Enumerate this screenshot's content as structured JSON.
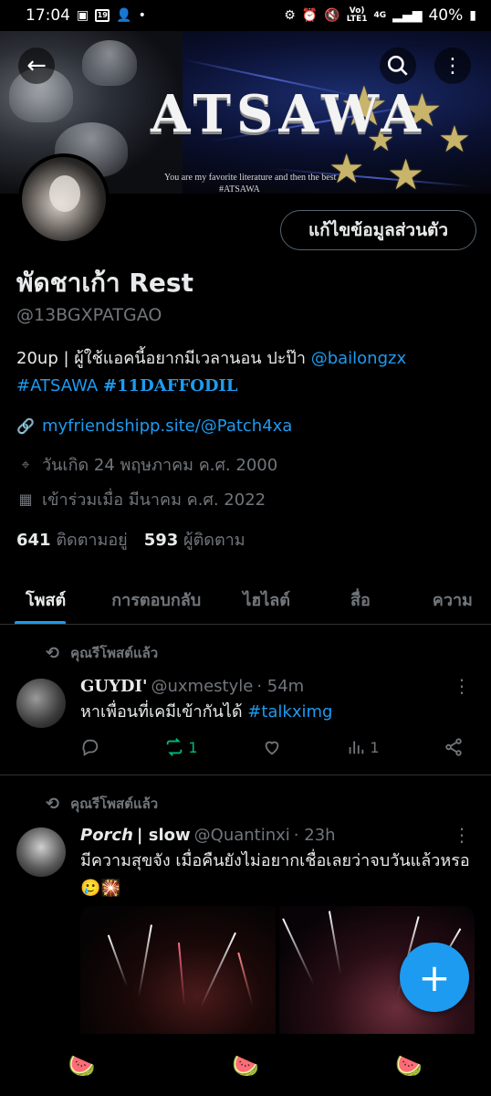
{
  "status_bar": {
    "time": "17:04",
    "notif_badge": "19",
    "net_top": "Vo)",
    "net_bottom": "LTE1",
    "net_gen": "4G",
    "battery": "40%"
  },
  "banner": {
    "title": "ATSAWA",
    "subtitle": "You are my favorite literature and then the best",
    "tag": "#ATSAWA"
  },
  "profile": {
    "edit_label": "แก้ไขข้อมูลส่วนตัว",
    "name": "พัดชาเก้า Rest",
    "handle": "@13BGXPATGAO",
    "bio_text": "20up | ผู้ใช้แอคนี้อยากมีเวลานอน ปะป๊า ",
    "bio_mention": "@bailongzx",
    "bio_tag1": "#ATSAWA",
    "bio_tag2": "#11DAFFODIL",
    "website": "myfriendshipp.site/@Patch4xa",
    "birthday": "วันเกิด 24 พฤษภาคม ค.ศ. 2000",
    "joined": "เข้าร่วมเมื่อ มีนาคม ค.ศ. 2022",
    "following_count": "641",
    "following_label": "ติดตามอยู่",
    "followers_count": "593",
    "followers_label": "ผู้ติดตาม"
  },
  "tabs": [
    "โพสต์",
    "การตอบกลับ",
    "ไฮไลต์",
    "สื่อ",
    "ความ"
  ],
  "posts": [
    {
      "repost_label": "คุณรีโพสต์แล้ว",
      "name": "GUYDI'",
      "handle": "@uxmestyle",
      "time": "· 54m",
      "text": "หาเพื่อนที่เคมีเข้ากันได้ ",
      "hashtag": "#talkximg",
      "reposts": "1",
      "views": "1"
    },
    {
      "repost_label": "คุณรีโพสต์แล้ว",
      "name": "Porch",
      "name_suffix": "| slow",
      "handle": "@Quantinxi",
      "time": "· 23h",
      "text": "มีความสุขจัง เมื่อคืนยังไม่อยากเชื่อเลยว่าจบวันแล้วหรอ",
      "emoji": "🥲🎇"
    }
  ],
  "colors": {
    "accent": "#1d9bf0",
    "muted": "#71767b",
    "repost_green": "#00ba7c"
  }
}
